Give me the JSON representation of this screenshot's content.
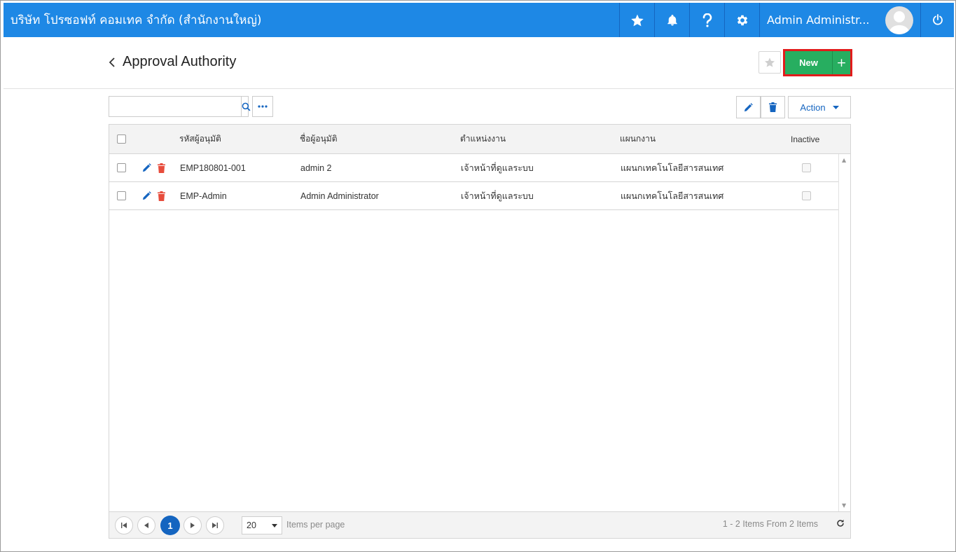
{
  "topbar": {
    "company": "บริษัท โปรซอฟท์ คอมเทค จำกัด (สำนักงานใหญ่)",
    "user_name": "Admin Administr...",
    "icons": [
      "star-icon",
      "bell-icon",
      "help-icon",
      "gear-icon",
      "power-icon"
    ]
  },
  "page": {
    "title": "Approval Authority",
    "new_label": "New",
    "new_plus": "+"
  },
  "toolbar": {
    "search_placeholder": "",
    "action_label": "Action"
  },
  "grid": {
    "columns": [
      "รหัสผู้อนุมัติ",
      "ชื่อผู้อนุมัติ",
      "ตำแหน่งงาน",
      "แผนกงาน",
      "Inactive"
    ],
    "rows": [
      {
        "code": "EMP180801-001",
        "name": "admin 2",
        "position": "เจ้าหน้าที่ดูแลระบบ",
        "department": "แผนกเทคโนโลยีสารสนเทศ",
        "inactive": false
      },
      {
        "code": "EMP-Admin",
        "name": "Admin Administrator",
        "position": "เจ้าหน้าที่ดูแลระบบ",
        "department": "แผนกเทคโนโลยีสารสนเทศ",
        "inactive": false
      }
    ]
  },
  "pager": {
    "current_page": "1",
    "page_size": "20",
    "items_per_page_label": "Items per page",
    "info": "1 - 2 Items From 2 Items"
  },
  "colors": {
    "topbar": "#1e88e5",
    "new_button": "#27ae60",
    "highlight_border": "#e21b1b",
    "delete_icon": "#e74c3c",
    "accent": "#1565c0"
  }
}
